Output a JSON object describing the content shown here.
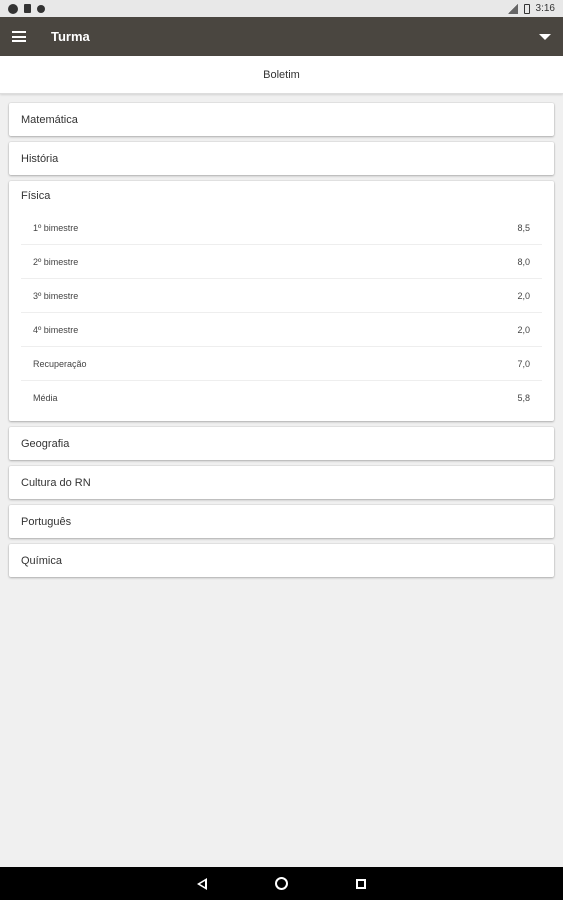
{
  "status_bar": {
    "time": "3:16",
    "icons": [
      "vpn-icon",
      "sd-card-icon",
      "settings-icon",
      "signal-icon",
      "battery-icon"
    ]
  },
  "app_bar": {
    "title": "Turma",
    "menu_icon": "hamburger-menu-icon",
    "dropdown_icon": "dropdown-arrow-icon",
    "background": "#4a4640"
  },
  "subheader": {
    "title": "Boletim"
  },
  "subjects": [
    {
      "name": "Matemática"
    },
    {
      "name": "História"
    },
    {
      "name": "Física",
      "grades": [
        {
          "label": "1º bimestre",
          "value": "8,5"
        },
        {
          "label": "2º bimestre",
          "value": "8,0"
        },
        {
          "label": "3º bimestre",
          "value": "2,0"
        },
        {
          "label": "4º bimestre",
          "value": "2,0"
        },
        {
          "label": "Recuperação",
          "value": "7,0"
        },
        {
          "label": "Média",
          "value": "5,8"
        }
      ]
    },
    {
      "name": "Geografia"
    },
    {
      "name": "Cultura do RN"
    },
    {
      "name": "Português"
    },
    {
      "name": "Química"
    }
  ],
  "nav_bar": {
    "icons": [
      "back-icon",
      "home-icon",
      "recents-icon"
    ]
  }
}
